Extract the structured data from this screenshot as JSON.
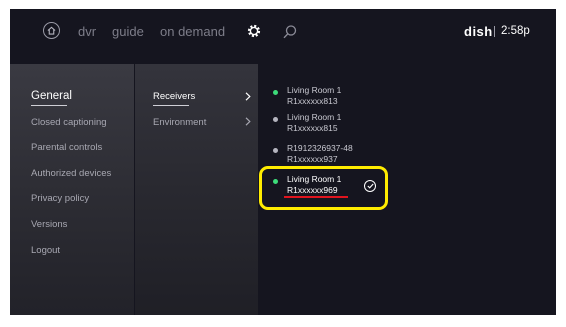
{
  "topbar": {
    "nav": [
      "dvr",
      "guide",
      "on demand"
    ],
    "logo": "dish",
    "time": "2:58p"
  },
  "settings_menu": {
    "items": [
      {
        "label": "General",
        "active": true
      },
      {
        "label": "Closed captioning"
      },
      {
        "label": "Parental controls"
      },
      {
        "label": "Authorized devices"
      },
      {
        "label": "Privacy policy"
      },
      {
        "label": "Versions"
      },
      {
        "label": "Logout"
      }
    ]
  },
  "general_menu": {
    "items": [
      {
        "label": "Receivers",
        "active": true
      },
      {
        "label": "Environment"
      }
    ]
  },
  "receivers": [
    {
      "name": "Living Room 1",
      "id": "R1xxxxxx813",
      "status": "online"
    },
    {
      "name": "Living Room 1",
      "id": "R1xxxxxx815",
      "status": "offline"
    },
    {
      "name": "R1912326937-48",
      "id": "R1xxxxxx937",
      "status": "offline"
    },
    {
      "name": "Living Room 1",
      "id": "R1xxxxxx969",
      "status": "online",
      "selected": true
    }
  ],
  "colors": {
    "online_dot": "#3ddc7a",
    "offline_dot": "#b5b5bf",
    "highlight": "#ffec00",
    "annotation_underline": "#e0141e"
  }
}
